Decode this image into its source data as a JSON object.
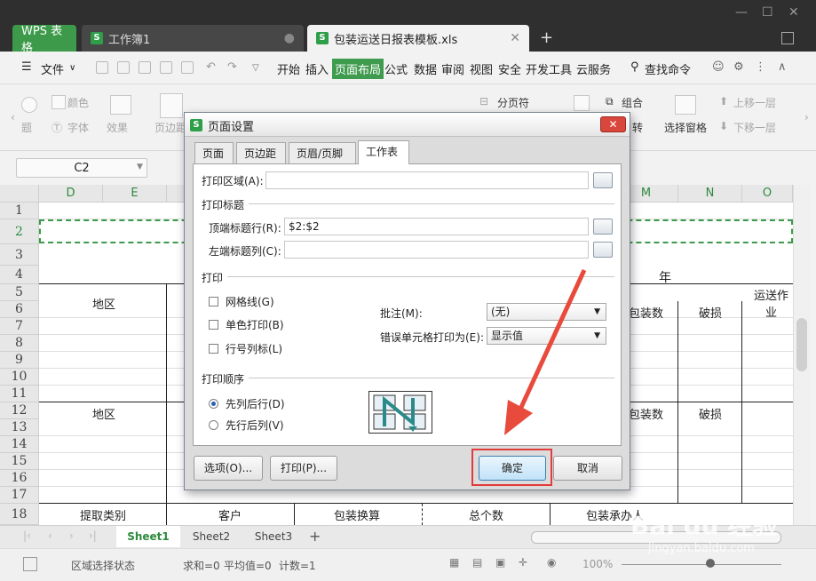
{
  "tabs": {
    "wps": "WPS 表格",
    "work": "工作簿1",
    "doc": "包装运送日报表模板.xls",
    "new": "+"
  },
  "menu": {
    "file": "文件",
    "items": [
      "开始",
      "插入",
      "页面布局",
      "公式",
      "数据",
      "审阅",
      "视图",
      "安全",
      "开发工具",
      "云服务"
    ],
    "search": "查找命令"
  },
  "ribbon": {
    "color": "颜色",
    "font": "字体",
    "effect": "效果",
    "theme_prefix": "题",
    "margin_prefix": "页边距",
    "page_break": "分页符",
    "group": "组合",
    "rotate_suffix": "转",
    "selection_pane": "选择窗格",
    "move_up": "上移一层",
    "move_down": "下移一层"
  },
  "formula": {
    "name_box": "C2"
  },
  "sheet": {
    "columns_left": [
      "D",
      "E"
    ],
    "columns_right": [
      "M",
      "N",
      "O"
    ],
    "rows": [
      "1",
      "2",
      "3",
      "4",
      "5",
      "6",
      "7",
      "8",
      "9",
      "10",
      "11",
      "12",
      "13",
      "14",
      "15",
      "16",
      "17",
      "18"
    ],
    "year": "年",
    "transport": "运送作业",
    "region": "地区",
    "pack_count": "包装数",
    "damage": "破损",
    "region2": "地区",
    "pack_count2": "包装数",
    "damage2": "破损",
    "footer_cells": [
      "提取类别",
      "客户",
      "包装换算",
      "总个数",
      "包装承办人"
    ]
  },
  "sheet_tabs": [
    "Sheet1",
    "Sheet2",
    "Sheet3"
  ],
  "status": {
    "mode": "区域选择状态",
    "sum": "求和=0",
    "avg": "平均值=0",
    "count": "计数=1",
    "zoom": "100%"
  },
  "dialog": {
    "title": "页面设置",
    "tabs": [
      "页面",
      "页边距",
      "页眉/页脚",
      "工作表"
    ],
    "print_area_label": "打印区域(A):",
    "print_area_value": "",
    "print_titles_section": "打印标题",
    "top_rows_label": "顶端标题行(R):",
    "top_rows_value": "$2:$2",
    "left_cols_label": "左端标题列(C):",
    "left_cols_value": "",
    "print_section": "打印",
    "gridlines": "网格线(G)",
    "mono": "单色打印(B)",
    "row_col_headers": "行号列标(L)",
    "comments_label": "批注(M):",
    "comments_value": "(无)",
    "errors_label": "错误单元格打印为(E):",
    "errors_value": "显示值",
    "order_section": "打印顺序",
    "down_then_over": "先列后行(D)",
    "over_then_down": "先行后列(V)",
    "options_button": "选项(O)...",
    "print_button": "打印(P)...",
    "ok_button": "确定",
    "cancel_button": "取消"
  },
  "watermark": {
    "brand": "Bai du 经验",
    "url": "jingyan.baidu.com"
  },
  "colors": {
    "accent_green": "#3f9b4e",
    "highlight_red": "#e23b3b",
    "dialog_close": "#d9463c"
  }
}
